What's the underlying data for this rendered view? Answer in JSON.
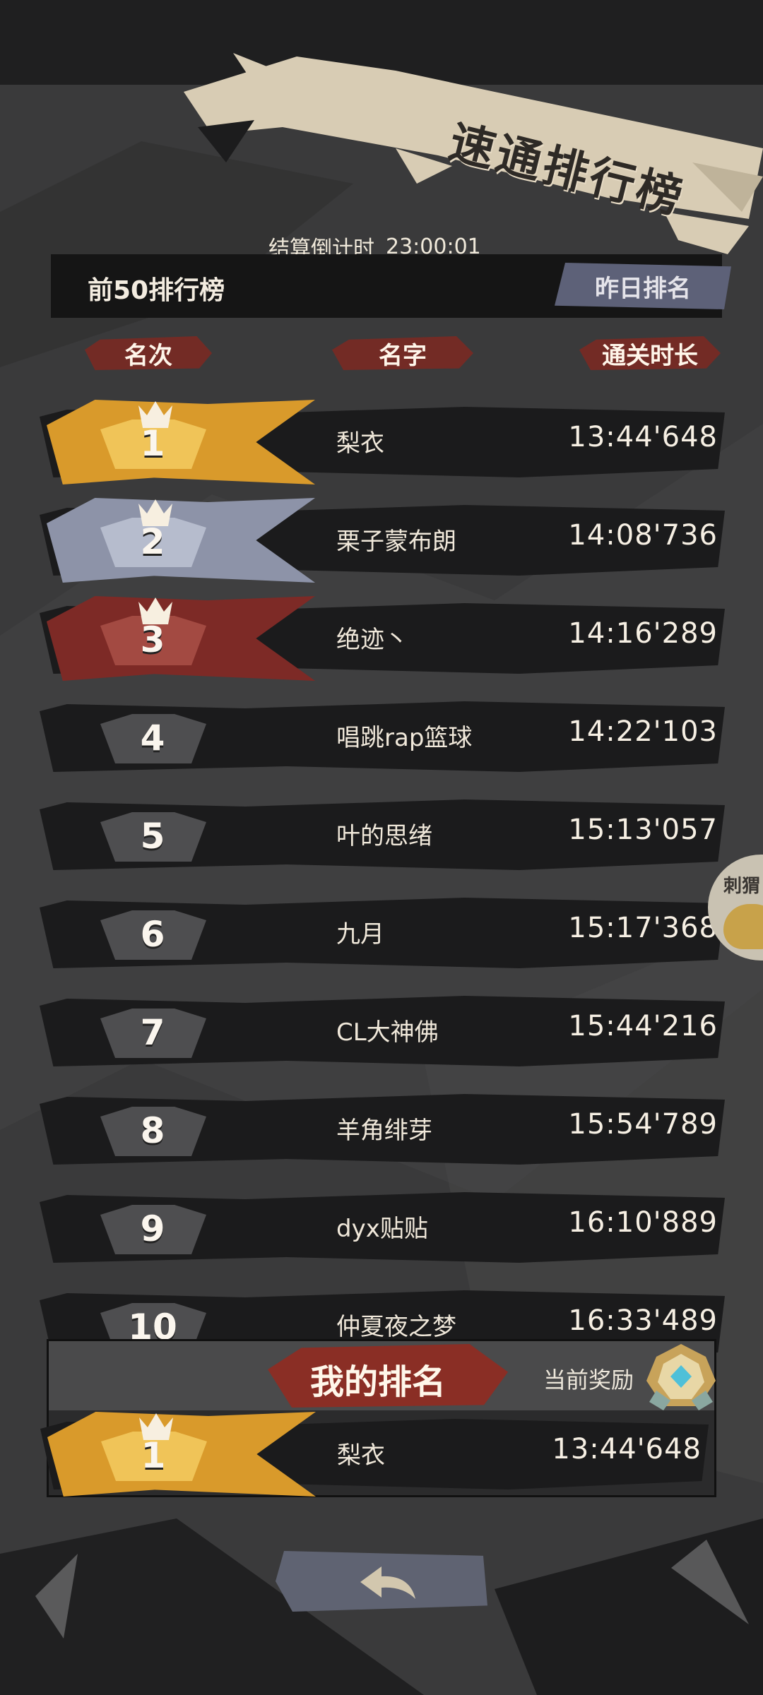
{
  "title": "速通排行榜",
  "countdown": {
    "label": "结算倒计时",
    "value": "23:00:01"
  },
  "board": {
    "label": "前50排行榜",
    "yesterday_button": "昨日排名"
  },
  "columns": {
    "rank": "名次",
    "name": "名字",
    "time": "通关时长"
  },
  "rows": [
    {
      "rank": "1",
      "name": "梨衣",
      "time": "13:44'648",
      "tier": "gold"
    },
    {
      "rank": "2",
      "name": "栗子蒙布朗",
      "time": "14:08'736",
      "tier": "silver"
    },
    {
      "rank": "3",
      "name": "绝迹丶",
      "time": "14:16'289",
      "tier": "bronze"
    },
    {
      "rank": "4",
      "name": "唱跳rap篮球",
      "time": "14:22'103",
      "tier": "normal"
    },
    {
      "rank": "5",
      "name": "叶的思绪",
      "time": "15:13'057",
      "tier": "normal"
    },
    {
      "rank": "6",
      "name": "九月",
      "time": "15:17'368",
      "tier": "normal"
    },
    {
      "rank": "7",
      "name": "CL大神佛",
      "time": "15:44'216",
      "tier": "normal"
    },
    {
      "rank": "8",
      "name": "羊角绯芽",
      "time": "15:54'789",
      "tier": "normal"
    },
    {
      "rank": "9",
      "name": "dyx贴贴",
      "time": "16:10'889",
      "tier": "normal"
    },
    {
      "rank": "10",
      "name": "仲夏夜之梦",
      "time": "16:33'489",
      "tier": "normal"
    }
  ],
  "my_rank": {
    "title": "我的排名",
    "reward_label": "当前奖励",
    "rank": "1",
    "name": "梨衣",
    "time": "13:44'648",
    "tier": "gold"
  },
  "side_tab": {
    "label": "刺猬"
  },
  "icons": {
    "back": "back-arrow-icon",
    "reward": "reward-medal-icon",
    "crown": "crown-icon"
  },
  "colors": {
    "gold": "#d99a2b",
    "silver": "#8d93a8",
    "bronze": "#7d2a26",
    "normal": "#4a4a4c"
  }
}
